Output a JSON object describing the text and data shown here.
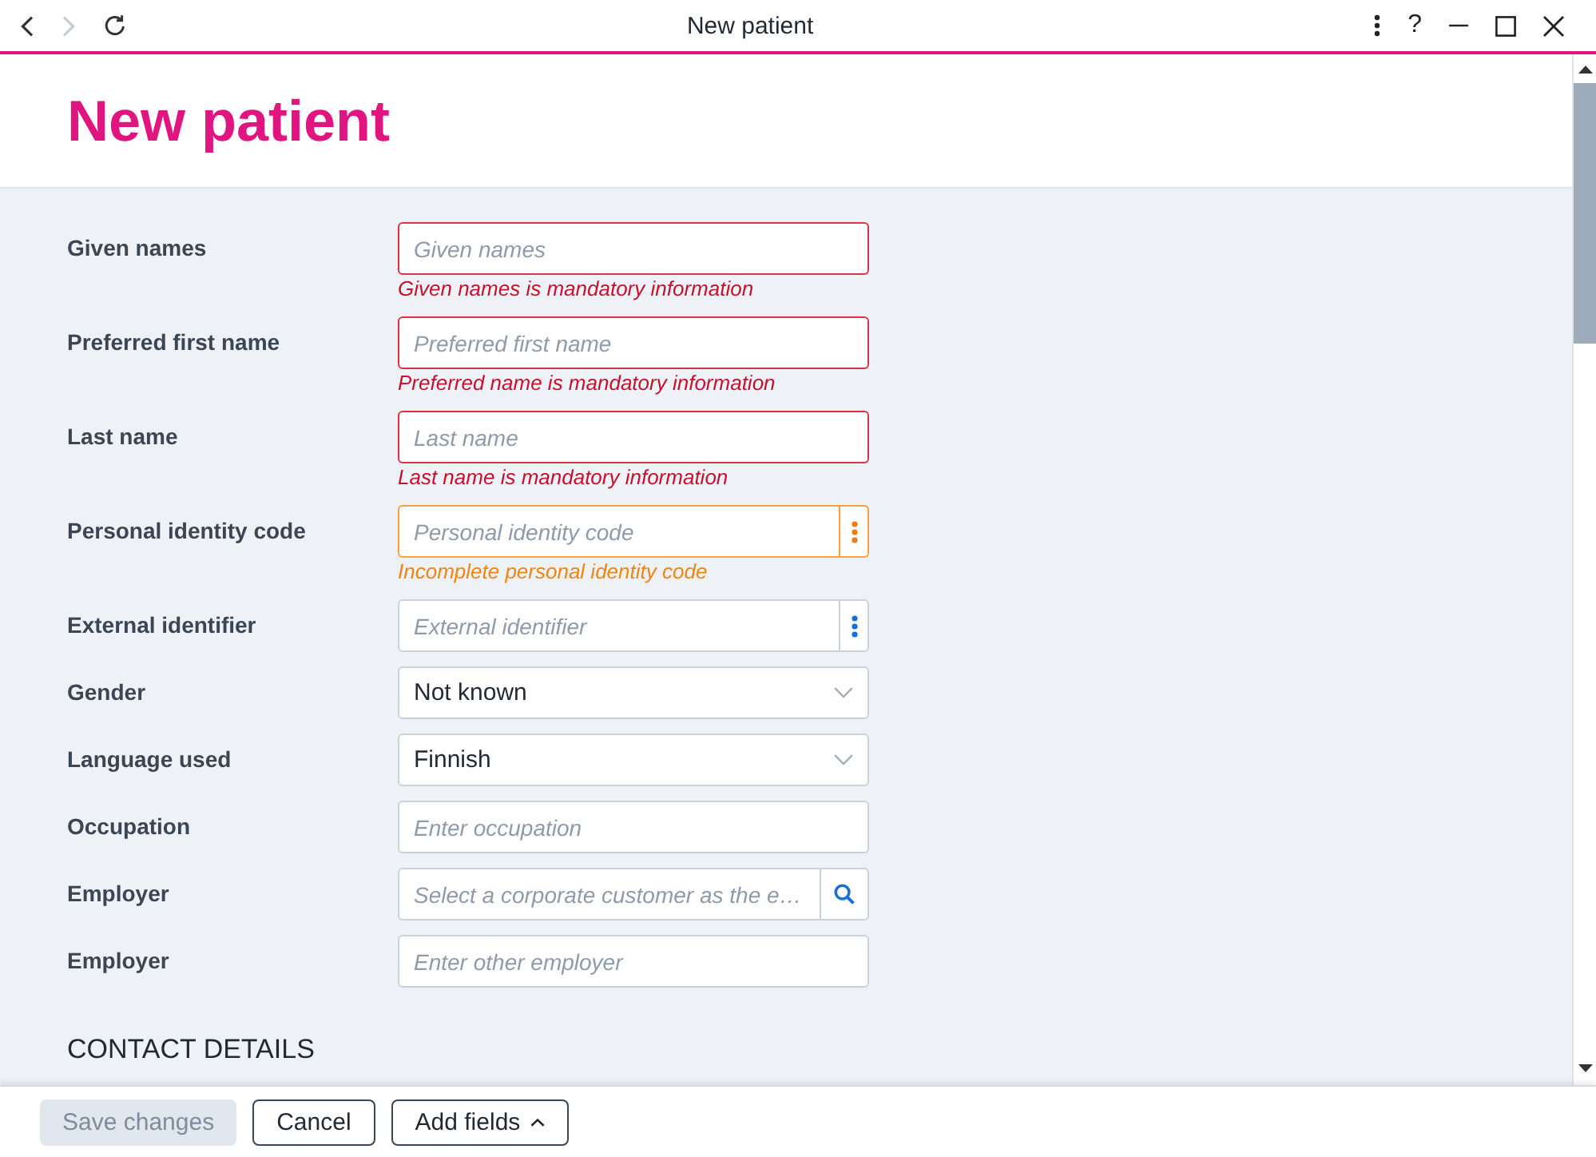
{
  "window": {
    "title": "New patient",
    "nav": [
      {
        "kind": "back",
        "disabled": false
      },
      {
        "kind": "forward",
        "disabled": true
      },
      {
        "kind": "refresh",
        "disabled": false
      }
    ],
    "help_button": "?"
  },
  "page": {
    "heading": "New patient"
  },
  "form": {
    "fields": [
      {
        "label": "Given names",
        "kind": "text",
        "placeholder": "Given names",
        "error": true,
        "warning": false,
        "message": "Given names is mandatory information"
      },
      {
        "label": "Preferred first name",
        "kind": "text",
        "placeholder": "Preferred first name",
        "error": true,
        "warning": false,
        "message": "Preferred name is mandatory information"
      },
      {
        "label": "Last name",
        "kind": "text",
        "placeholder": "Last name",
        "error": true,
        "warning": false,
        "message": "Last name is mandatory information"
      },
      {
        "label": "Personal identity code",
        "kind": "menu",
        "placeholder": "Personal identity code",
        "error": false,
        "warning": true,
        "message": "Incomplete personal identity code"
      },
      {
        "label": "External identifier",
        "kind": "menu",
        "placeholder": "External identifier",
        "error": false,
        "warning": false
      },
      {
        "label": "Gender",
        "kind": "select",
        "value": "Not known",
        "error": false,
        "warning": false
      },
      {
        "label": "Language used",
        "kind": "select",
        "value": "Finnish",
        "error": false,
        "warning": false
      },
      {
        "label": "Occupation",
        "kind": "text",
        "placeholder": "Enter occupation",
        "error": false,
        "warning": false
      },
      {
        "label": "Employer",
        "kind": "search",
        "placeholder": "Select a corporate customer as the e…",
        "error": false,
        "warning": false
      },
      {
        "label": "Employer",
        "kind": "text",
        "placeholder": "Enter other employer",
        "error": false,
        "warning": false
      }
    ]
  },
  "section": {
    "heading": "CONTACT DETAILS"
  },
  "footer": {
    "buttons": [
      {
        "label": "Save changes",
        "kind": "primary",
        "disabled": true
      },
      {
        "label": "Cancel",
        "kind": "secondary",
        "disabled": false
      },
      {
        "label": "Add fields",
        "kind": "menu",
        "disabled": false
      }
    ]
  }
}
